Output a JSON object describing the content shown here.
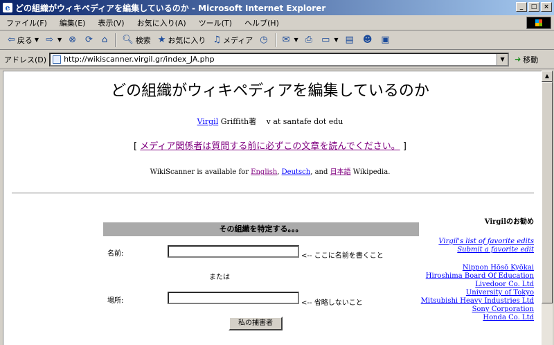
{
  "window": {
    "title": "どの組織がウィキペディアを編集しているのか - Microsoft Internet Explorer",
    "controls": {
      "minimize": "_",
      "maximize": "□",
      "close": "×"
    }
  },
  "menu": [
    "ファイル(F)",
    "編集(E)",
    "表示(V)",
    "お気に入り(A)",
    "ツール(T)",
    "ヘルプ(H)"
  ],
  "toolbar": {
    "back": "戻る",
    "search": "検索",
    "favorites": "お気に入り",
    "media": "メディア"
  },
  "address": {
    "label": "アドレス(D)",
    "url": "http://wikiscanner.virgil.gr/index_JA.php",
    "go": "移動"
  },
  "page": {
    "title": "どの組織がウィキペディアを編集しているのか",
    "author_link": "Virgil",
    "author_rest": " Griffith著　 v at santafe dot edu",
    "notice_open": "[ ",
    "notice_link": "メディア関係者は質問する前に必ずこの文章を読んでください。",
    "notice_close": " ]",
    "avail_pre": "WikiScanner is available for ",
    "avail_en": "English",
    "avail_sep1": ", ",
    "avail_de": "Deutsch",
    "avail_sep2": ", and ",
    "avail_ja": "日本語",
    "avail_post": " Wikipedia."
  },
  "form": {
    "header": "その組織を特定する。。。",
    "name_label": "名前:",
    "name_hint": "<-- ここに名前を書くこと",
    "or": "または",
    "location_label": "場所:",
    "location_hint": "<-- 省略しないこと",
    "submit": "私の捕害者"
  },
  "sidebar": {
    "heading": "Virgilのお勧め",
    "links_italic": [
      "Virgil's list of favorite edits",
      "Submit a favorite edit"
    ],
    "orgs": [
      "Nippon Hōsō Kyōkai",
      "Hiroshima Board Of Education",
      "Livedoor Co. Ltd",
      "University of Tokyo",
      "Mitsubishi Heavy Industries Ltd",
      "Sony Corporation",
      "Honda Co. Ltd"
    ]
  },
  "colors": {
    "link": "#0000ff",
    "visited": "#800080",
    "titlebar": "#0a246a"
  }
}
